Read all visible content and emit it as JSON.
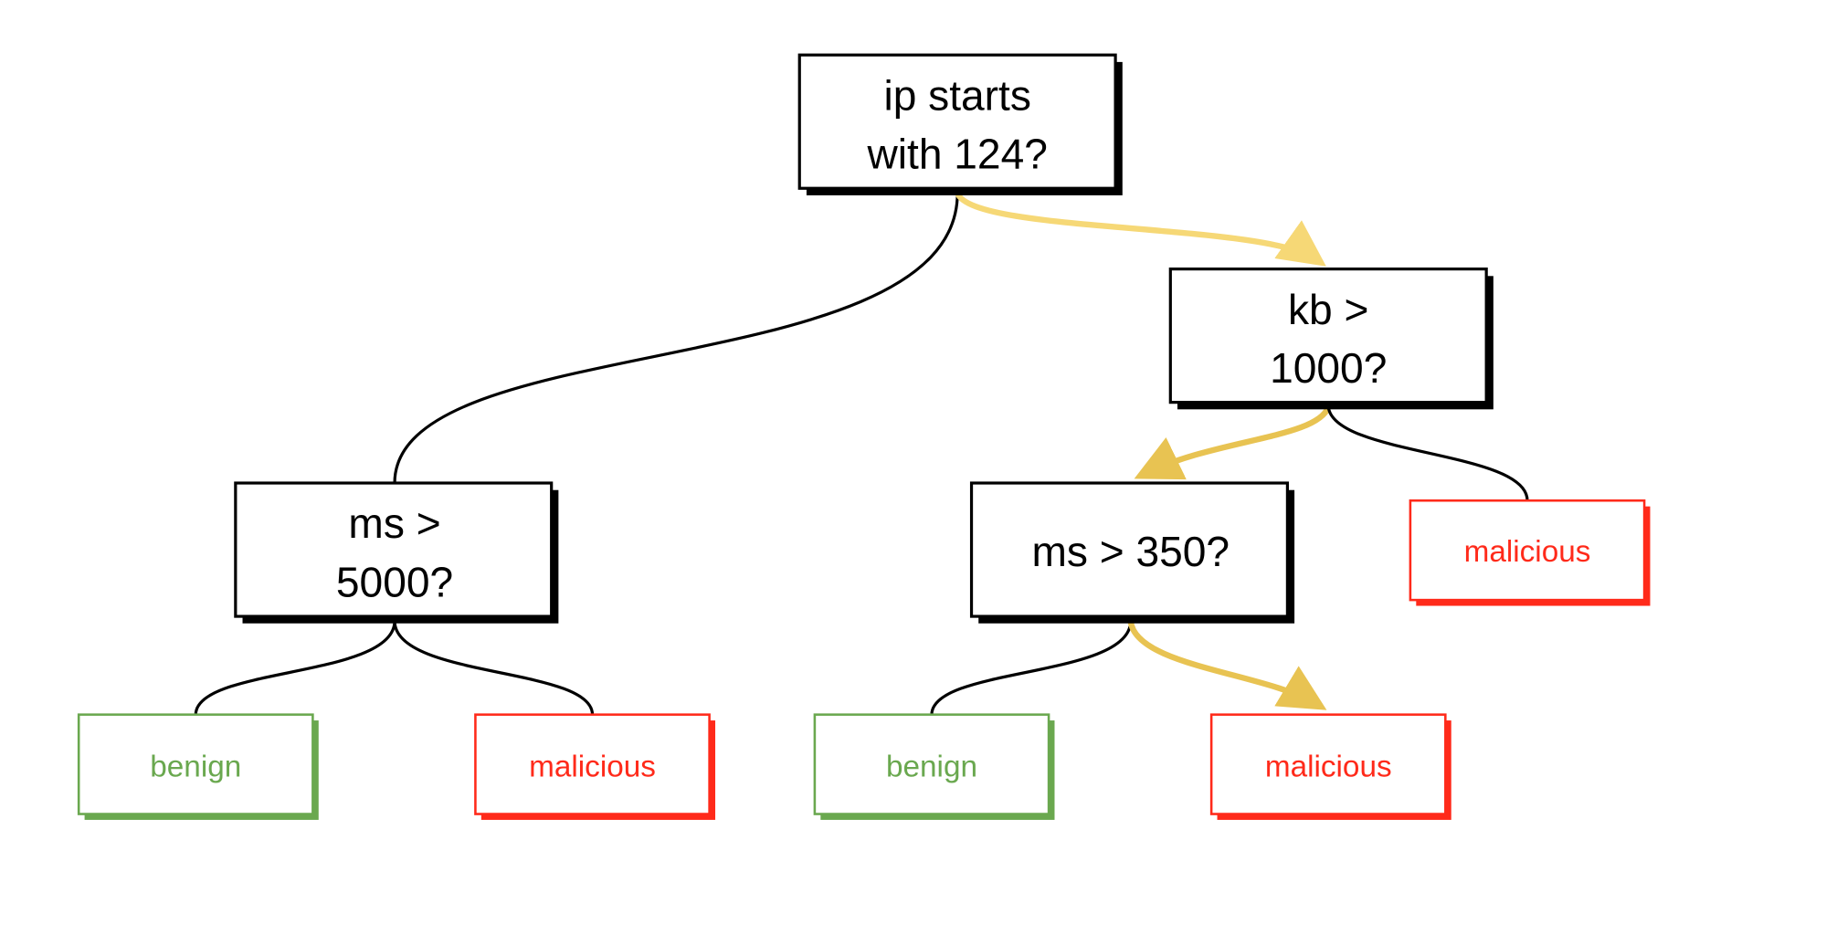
{
  "colors": {
    "decision_border": "#000000",
    "benign": "#6aa84f",
    "malicious": "#ff2a1a",
    "path_highlight_light": "#f6d876",
    "path_highlight": "#e8c352"
  },
  "nodes": {
    "root": {
      "line1": "ip starts",
      "line2": "with 124?"
    },
    "kb": {
      "line1": "kb >",
      "line2": "1000?"
    },
    "ms5000": {
      "line1": "ms >",
      "line2": "5000?"
    },
    "ms350": {
      "line1": "ms > 350?"
    },
    "kb_right_leaf": "malicious",
    "ms5000_left_leaf": "benign",
    "ms5000_right_leaf": "malicious",
    "ms350_left_leaf": "benign",
    "ms350_right_leaf": "malicious"
  },
  "highlighted_path": [
    "root",
    "kb",
    "ms350",
    "ms350_right_leaf"
  ]
}
